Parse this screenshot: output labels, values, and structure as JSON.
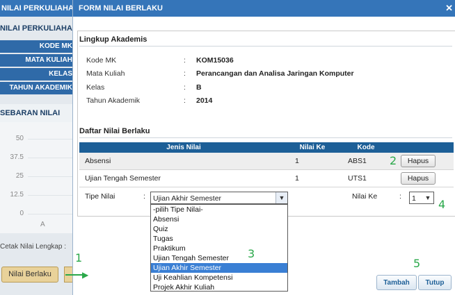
{
  "background": {
    "topbar_title": "NILAI PERKULIAHAN",
    "subheader": "NILAI PERKULIAHAN",
    "info_rows": [
      "KODE MK",
      "MATA KULIAH",
      "KELAS",
      "TAHUN AKADEMIK"
    ],
    "sebaran_title": "SEBARAN NILAI",
    "chart_ticks": [
      "50",
      "37.5",
      "25",
      "12.5",
      "0"
    ],
    "chart_xlabel": "A",
    "cetak_label": "Cetak Nilai Lengkap :",
    "nilai_berlaku_button": "Nilai Berlaku"
  },
  "modal": {
    "title": "FORM NILAI BERLAKU",
    "close_icon": "close-icon",
    "lingkup": {
      "title": "Lingkup Akademis",
      "fields": [
        {
          "label": "Kode MK",
          "value": "KOM15036"
        },
        {
          "label": "Mata Kuliah",
          "value": "Perancangan dan Analisa Jaringan Komputer"
        },
        {
          "label": "Kelas",
          "value": "B"
        },
        {
          "label": "Tahun Akademik",
          "value": "2014"
        }
      ]
    },
    "daftar": {
      "title": "Daftar Nilai Berlaku",
      "headers": [
        "Jenis Nilai",
        "Nilai Ke",
        "Kode"
      ],
      "rows": [
        {
          "jenis": "Absensi",
          "nilai_ke": "1",
          "kode": "ABS1",
          "action": "Hapus"
        },
        {
          "jenis": "Ujian Tengah Semester",
          "nilai_ke": "1",
          "kode": "UTS1",
          "action": "Hapus"
        }
      ]
    },
    "form": {
      "tipe_label": "Tipe Nilai",
      "colon": ":",
      "tipe_selected": "Ujian Akhir Semester",
      "nilai_ke_label": "Nilai Ke",
      "nilai_ke_selected": "1",
      "options": [
        "-pilih Tipe Nilai-",
        "Absensi",
        "Quiz",
        "Tugas",
        "Praktikum",
        "Ujian Tengah Semester",
        "Ujian Akhir Semester",
        "Uji Keahlian Kompetensi",
        "Projek Akhir Kuliah"
      ],
      "highlighted_option": "Ujian Akhir Semester"
    },
    "buttons": {
      "tambah": "Tambah",
      "tutup": "Tutup"
    }
  },
  "annotations": [
    "1",
    "2",
    "3",
    "4",
    "5"
  ],
  "colors": {
    "header_blue": "#3575b9",
    "table_header": "#1d5f97",
    "highlight": "#3a7fd4",
    "annotation_green": "#2aa84a"
  }
}
